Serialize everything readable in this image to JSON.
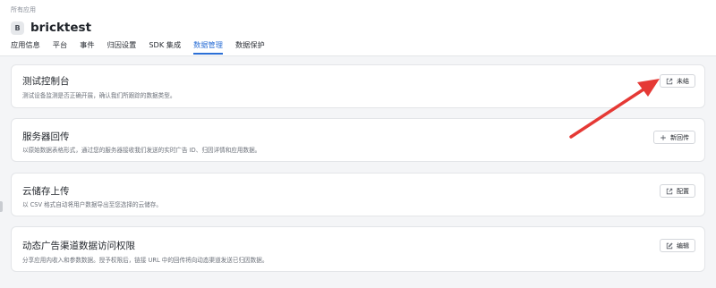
{
  "header": {
    "breadcrumb": "所有应用",
    "app_initial": "B",
    "app_name": "bricktest",
    "tabs": [
      {
        "label": "应用信息"
      },
      {
        "label": "平台"
      },
      {
        "label": "事件"
      },
      {
        "label": "归因设置"
      },
      {
        "label": "SDK 集成"
      },
      {
        "label": "数据管理"
      },
      {
        "label": "数据保护"
      }
    ],
    "active_tab": "数据管理"
  },
  "cards": [
    {
      "title": "测试控制台",
      "desc": "测试设备监测是否正确开展，确认我们所跟踪的数据类型。",
      "button": "未结",
      "button_icon": "external-link-icon"
    },
    {
      "title": "服务器回传",
      "desc": "以原始数据表格形式，通过您的服务器接收我们发送的实时广告 ID、归因详情和应用数据。",
      "button": "新回传",
      "button_icon": "plus-icon"
    },
    {
      "title": "云储存上传",
      "desc": "以 CSV 格式自动将用户数据导出至您选择的云储存。",
      "button": "配置",
      "button_icon": "external-link-icon"
    },
    {
      "title": "动态广告渠道数据访问权限",
      "desc": "分享应用内收入和参数数据。授予权限后，链接 URL 中的回传将向动态渠道发送已归因数据。",
      "button": "编辑",
      "button_icon": "edit-icon"
    }
  ],
  "colors": {
    "accent": "#2b6fd6",
    "annotation_arrow": "#e53935",
    "background": "#f4f5f7"
  }
}
